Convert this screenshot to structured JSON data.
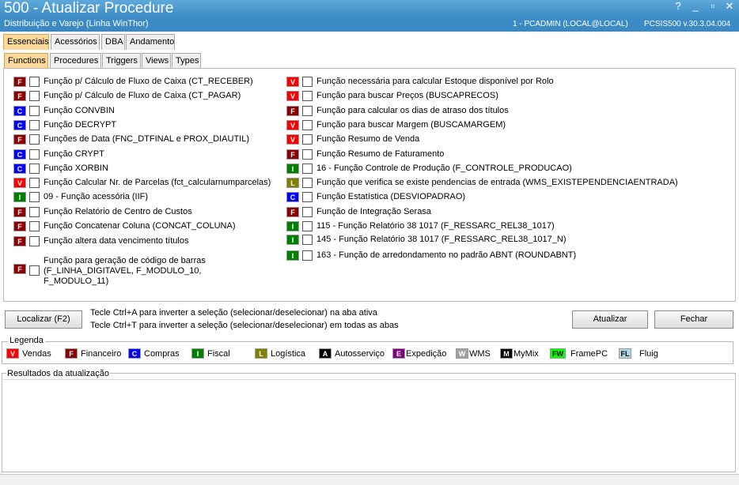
{
  "window": {
    "title": "500 - Atualizar Procedure",
    "subtitle": "Distribuição e Varejo (Linha WinThor)",
    "user_info": "1 - PCADMIN (LOCAL@LOCAL)",
    "system_info": "PCSIS500  v.30.3.04.004",
    "help_glyph": "?",
    "min_glyph": "_",
    "max_glyph": "▫",
    "close_glyph": "✕"
  },
  "main_tabs": [
    "Essenciais",
    "Acessórios",
    "DBA",
    "Andamento"
  ],
  "sub_tabs": [
    "Functions",
    "Procedures",
    "Triggers",
    "Views",
    "Types"
  ],
  "badge_colors": {
    "F": {
      "bg": "#8b0000",
      "fg": "#ffffff"
    },
    "C": {
      "bg": "#0000ff",
      "fg": "#ffffff"
    },
    "V": {
      "bg": "#ff0000",
      "fg": "#ffffff"
    },
    "I": {
      "bg": "#008000",
      "fg": "#ffffff"
    },
    "L": {
      "bg": "#808000",
      "fg": "#ffffff"
    },
    "A": {
      "bg": "#000000",
      "fg": "#ffffff"
    },
    "E": {
      "bg": "#800080",
      "fg": "#ffffff"
    },
    "W": {
      "bg": "#a0a0a0",
      "fg": "#ffffff"
    },
    "M": {
      "bg": "#000000",
      "fg": "#ffffff"
    },
    "FW": {
      "bg": "#00ff00",
      "fg": "#000000"
    },
    "FL": {
      "bg": "#add8e6",
      "fg": "#000000"
    }
  },
  "functions_left": [
    {
      "badge": "F",
      "label": "Função p/ Cálculo de Fluxo de Caixa (CT_RECEBER)"
    },
    {
      "badge": "F",
      "label": "Função p/ Cálculo de Fluxo de Caixa (CT_PAGAR)"
    },
    {
      "badge": "C",
      "label": "Função CONVBIN"
    },
    {
      "badge": "C",
      "label": "Função DECRYPT"
    },
    {
      "badge": "F",
      "label": "Funções de Data (FNC_DTFINAL e PROX_DIAUTIL)"
    },
    {
      "badge": "C",
      "label": "Função CRYPT"
    },
    {
      "badge": "C",
      "label": "Função XORBIN"
    },
    {
      "badge": "V",
      "label": "Função Calcular Nr. de Parcelas (fct_calcularnumparcelas)"
    },
    {
      "badge": "I",
      "label": "09 - Função acessória (IIF)"
    },
    {
      "badge": "F",
      "label": "Função Relatório de Centro de Custos"
    },
    {
      "badge": "F",
      "label": "Função Concatenar Coluna (CONCAT_COLUNA)"
    },
    {
      "badge": "F",
      "label": "Função altera data vencimento títulos"
    },
    {
      "badge": "F",
      "label": "Função para geração de código de barras (F_LINHA_DIGITAVEL, F_MODULO_10, F_MODULO_11)"
    }
  ],
  "functions_right": [
    {
      "badge": "V",
      "label": "Função necessária para calcular Estoque disponível por Rolo"
    },
    {
      "badge": "V",
      "label": "Função para buscar Preços (BUSCAPRECOS)"
    },
    {
      "badge": "F",
      "label": "Função para calcular os dias de atraso dos títulos"
    },
    {
      "badge": "V",
      "label": "Função para buscar Margem (BUSCAMARGEM)"
    },
    {
      "badge": "V",
      "label": "Função Resumo de Venda"
    },
    {
      "badge": "F",
      "label": "Função Resumo de Faturamento"
    },
    {
      "badge": "I",
      "label": "16 - Função Controle de Produção (F_CONTROLE_PRODUCAO)"
    },
    {
      "badge": "L",
      "label": "Função que verifica se existe pendencias de entrada (WMS_EXISTEPENDENCIAENTRADA)"
    },
    {
      "badge": "C",
      "label": "Função Estatística (DESVIOPADRAO)"
    },
    {
      "badge": "F",
      "label": "Função de Integração Serasa"
    },
    {
      "badge": "I",
      "label": "115 - Função Relatório 38 1017 (F_RESSARC_REL38_1017)"
    },
    {
      "badge": "I",
      "label": "145 - Função Relatório 38 1017 (F_RESSARC_REL38_1017_N)"
    },
    {
      "badge": "I",
      "label": "163 - Função de arredondamento no padrão ABNT (ROUNDABNT)"
    }
  ],
  "actions": {
    "localizar": "Localizar (F2)",
    "hint1": "Tecle Ctrl+A para inverter a seleção (selecionar/deselecionar) na aba ativa",
    "hint2": "Tecle Ctrl+T para inverter a seleção (selecionar/deselecionar) em todas as abas",
    "atualizar": "Atualizar",
    "fechar": "Fechar"
  },
  "legend": {
    "title": "Legenda",
    "items": [
      {
        "badge": "V",
        "label": "Vendas"
      },
      {
        "badge": "F",
        "label": "Financeiro"
      },
      {
        "badge": "C",
        "label": "Compras"
      },
      {
        "badge": "I",
        "label": "Fiscal"
      },
      {
        "badge": "L",
        "label": "Logística"
      },
      {
        "badge": "A",
        "label": "Autosserviço"
      },
      {
        "badge": "E",
        "label": "Expedição"
      },
      {
        "badge": "W",
        "label": "WMS"
      },
      {
        "badge": "M",
        "label": "MyMix"
      },
      {
        "badge": "FW",
        "label": "FramePC"
      },
      {
        "badge": "FL",
        "label": "Fluig"
      }
    ]
  },
  "results": {
    "title": "Resultados da atualização"
  }
}
